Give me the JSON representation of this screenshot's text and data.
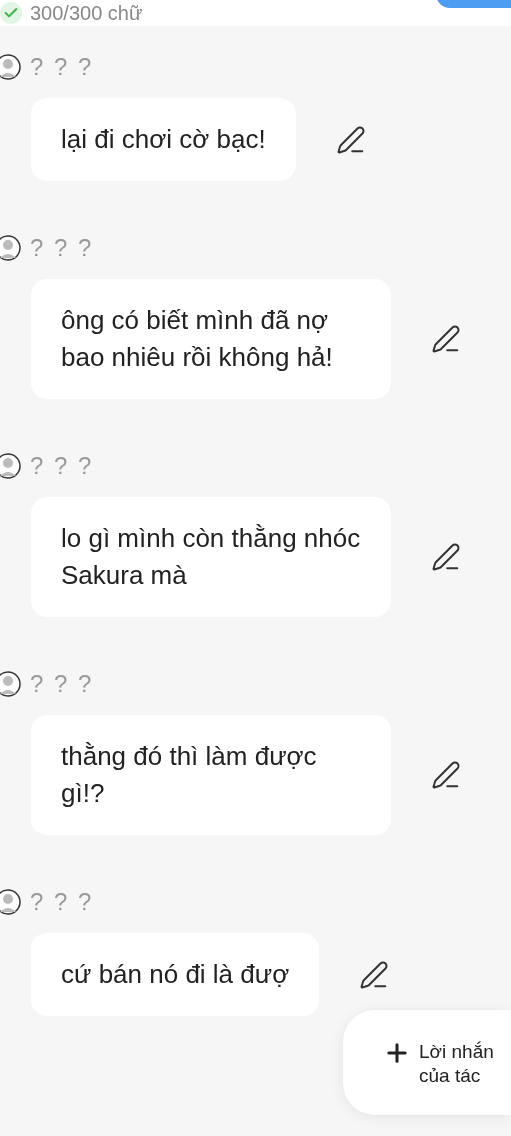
{
  "header": {
    "counter": "300/300 chữ",
    "checked": true
  },
  "messages": [
    {
      "speaker": "? ? ?",
      "text": "lại đi chơi cờ bạc!"
    },
    {
      "speaker": "? ? ?",
      "text": "ông có biết mình đã nợ bao nhiêu rồi không hả!"
    },
    {
      "speaker": "? ? ?",
      "text": "lo gì mình còn thằng nhóc Sakura mà"
    },
    {
      "speaker": "? ? ?",
      "text": "thằng đó thì làm được gì!?"
    },
    {
      "speaker": "? ? ?",
      "text": "cứ bán nó đi là đượ"
    }
  ],
  "floating_button": {
    "lines": [
      "Lời nhắn",
      "của tác"
    ]
  }
}
